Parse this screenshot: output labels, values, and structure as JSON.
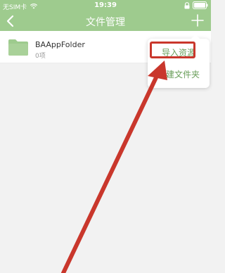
{
  "status_bar": {
    "carrier": "无SIM卡",
    "time": "19:39"
  },
  "navbar": {
    "title": "文件管理"
  },
  "file_list": [
    {
      "name": "BAAppFolder",
      "count": "0项"
    }
  ],
  "popup_menu": {
    "items": [
      {
        "label": "导入资源"
      },
      {
        "label": "新建文件夹"
      }
    ]
  },
  "colors": {
    "nav_bg": "#9ecb8e",
    "menu_text": "#6a9e5a",
    "annotation_red": "#c9372c",
    "folder": "#9ecb8e"
  },
  "icons": [
    "back-chevron-icon",
    "add-plus-icon",
    "folder-icon",
    "lock-icon",
    "battery-icon",
    "wifi-icon"
  ]
}
